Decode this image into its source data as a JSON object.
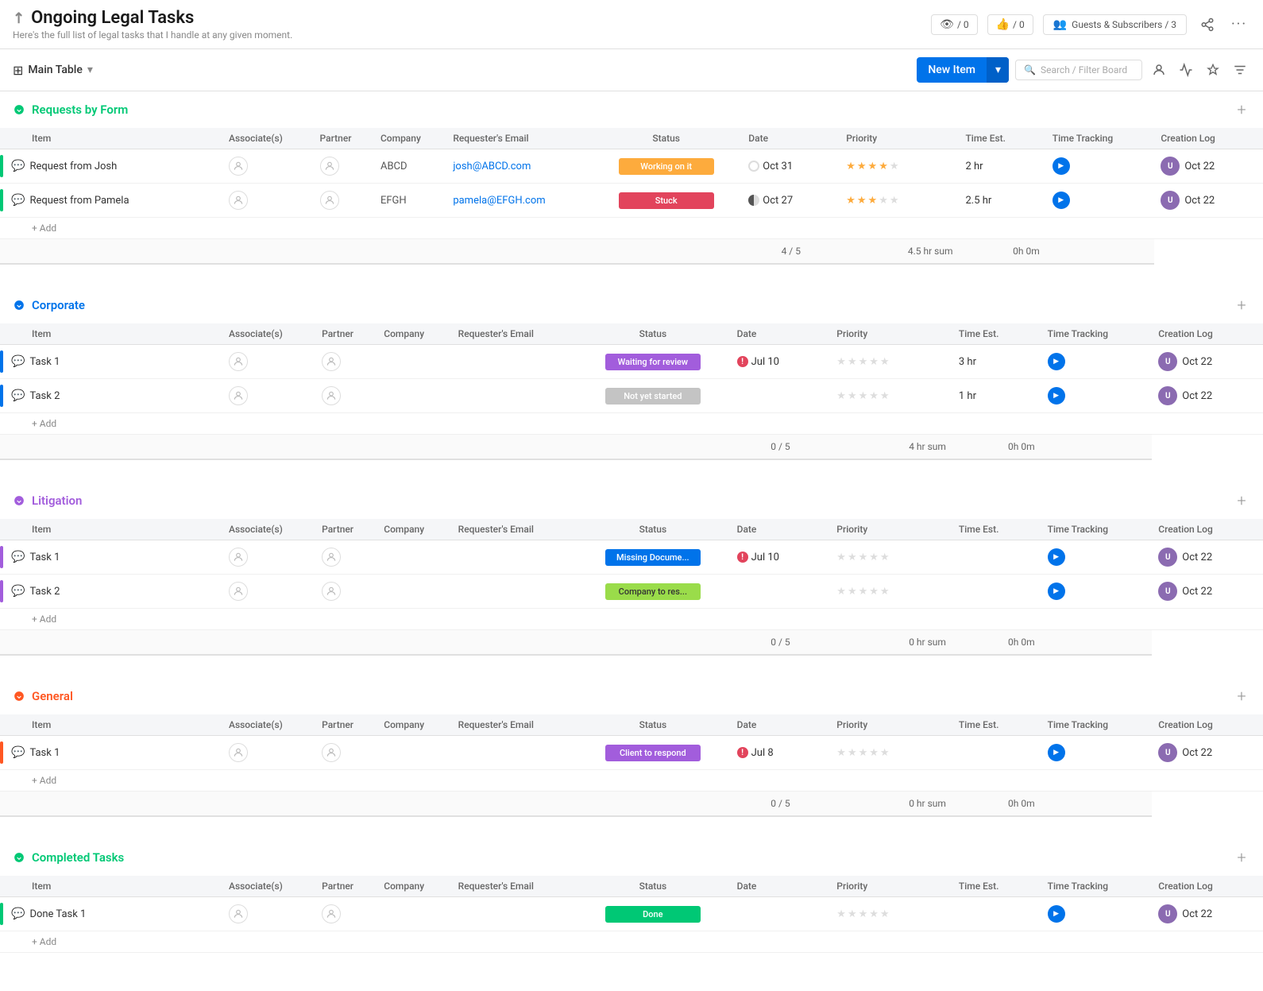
{
  "header": {
    "title": "Ongoing Legal Tasks",
    "subtitle": "Here's the full list of legal tasks that I handle at any given moment.",
    "icon": "↗",
    "guests_label": "Guests & Subscribers / 3",
    "viewers_count": "/ 0",
    "likes_count": "/ 0"
  },
  "toolbar": {
    "table_label": "Main Table",
    "new_item_label": "New Item",
    "search_placeholder": "Search / Filter Board"
  },
  "groups": [
    {
      "id": "requests",
      "name": "Requests by Form",
      "color_class": "green-group",
      "icon": "✓",
      "icon_color": "#00c875",
      "columns": [
        "Associate(s)",
        "Partner",
        "Company",
        "Requester's Email",
        "Status",
        "Date",
        "Priority",
        "Time Est.",
        "Time Tracking",
        "Creation Log"
      ],
      "rows": [
        {
          "name": "Request from Josh",
          "company": "ABCD",
          "email": "josh@ABCD.com",
          "status": "Working on it",
          "status_class": "status-working",
          "date": "Oct 31",
          "date_indicator": "empty",
          "priority": 4,
          "time_est": "2 hr",
          "log_date": "Oct 22"
        },
        {
          "name": "Request from Pamela",
          "company": "EFGH",
          "email": "pamela@EFGH.com",
          "status": "Stuck",
          "status_class": "status-stuck",
          "date": "Oct 27",
          "date_indicator": "half",
          "priority": 3,
          "time_est": "2.5 hr",
          "log_date": "Oct 22"
        }
      ],
      "summary": {
        "priority": "4 / 5",
        "time_est": "4.5 hr",
        "time_est_label": "sum",
        "time_tracking": "0h 0m"
      }
    },
    {
      "id": "corporate",
      "name": "Corporate",
      "color_class": "blue-group",
      "icon": "○",
      "icon_color": "#0073ea",
      "columns": [
        "Associate(s)",
        "Partner",
        "Company",
        "Requester's Email",
        "Status",
        "Date",
        "Priority",
        "Time Est.",
        "Time Tracking",
        "Creation Log"
      ],
      "rows": [
        {
          "name": "Task 1",
          "company": "",
          "email": "",
          "status": "Waiting for review",
          "status_class": "status-waiting",
          "date": "Jul 10",
          "date_indicator": "alert",
          "priority": 0,
          "time_est": "3 hr",
          "log_date": "Oct 22"
        },
        {
          "name": "Task 2",
          "company": "",
          "email": "",
          "status": "Not yet started",
          "status_class": "status-not-started",
          "date": "",
          "date_indicator": "none",
          "priority": 0,
          "time_est": "1 hr",
          "log_date": "Oct 22"
        }
      ],
      "summary": {
        "priority": "0 / 5",
        "time_est": "4 hr",
        "time_est_label": "sum",
        "time_tracking": "0h 0m"
      }
    },
    {
      "id": "litigation",
      "name": "Litigation",
      "color_class": "purple-group",
      "icon": "○",
      "icon_color": "#a25ddc",
      "columns": [
        "Associate(s)",
        "Partner",
        "Company",
        "Requester's Email",
        "Status",
        "Date",
        "Priority",
        "Time Est.",
        "Time Tracking",
        "Creation Log"
      ],
      "rows": [
        {
          "name": "Task 1",
          "company": "",
          "email": "",
          "status": "Missing Docume...",
          "status_class": "status-missing",
          "date": "Jul 10",
          "date_indicator": "alert",
          "priority": 0,
          "time_est": "",
          "log_date": "Oct 22"
        },
        {
          "name": "Task 2",
          "company": "",
          "email": "",
          "status": "Company to res...",
          "status_class": "status-company",
          "date": "",
          "date_indicator": "none",
          "priority": 0,
          "time_est": "",
          "log_date": "Oct 22"
        }
      ],
      "summary": {
        "priority": "0 / 5",
        "time_est": "0 hr",
        "time_est_label": "sum",
        "time_tracking": "0h 0m"
      }
    },
    {
      "id": "general",
      "name": "General",
      "color_class": "orange-group",
      "icon": "●",
      "icon_color": "#ff5722",
      "columns": [
        "Associate(s)",
        "Partner",
        "Company",
        "Requester's Email",
        "Status",
        "Date",
        "Priority",
        "Time Est.",
        "Time Tracking",
        "Creation Log"
      ],
      "rows": [
        {
          "name": "Task 1",
          "company": "",
          "email": "",
          "status": "Client to respond",
          "status_class": "status-client",
          "date": "Jul 8",
          "date_indicator": "alert",
          "priority": 0,
          "time_est": "",
          "log_date": "Oct 22"
        }
      ],
      "summary": {
        "priority": "0 / 5",
        "time_est": "0 hr",
        "time_est_label": "sum",
        "time_tracking": "0h 0m"
      }
    },
    {
      "id": "completed",
      "name": "Completed Tasks",
      "color_class": "green2-group",
      "icon": "✓",
      "icon_color": "#00c875",
      "columns": [
        "Associate(s)",
        "Partner",
        "Company",
        "Requester's Email",
        "Status",
        "Date",
        "Priority",
        "Time Est.",
        "Time Tracking",
        "Creation Log"
      ],
      "rows": [
        {
          "name": "Done Task 1",
          "company": "",
          "email": "",
          "status": "Done",
          "status_class": "status-done",
          "date": "",
          "date_indicator": "none",
          "priority": 0,
          "time_est": "",
          "log_date": "Oct 22"
        }
      ],
      "summary": null
    }
  ],
  "add_label": "+ Add",
  "icons": {
    "chat": "💬",
    "person": "👤",
    "play": "▶",
    "chevron_down": "▾",
    "grid": "▦",
    "search": "🔍",
    "user": "👤",
    "refresh": "↺",
    "pin": "📌",
    "filter": "☰",
    "more": "⋯",
    "plus": "+",
    "check": "✓",
    "circle": "○"
  }
}
